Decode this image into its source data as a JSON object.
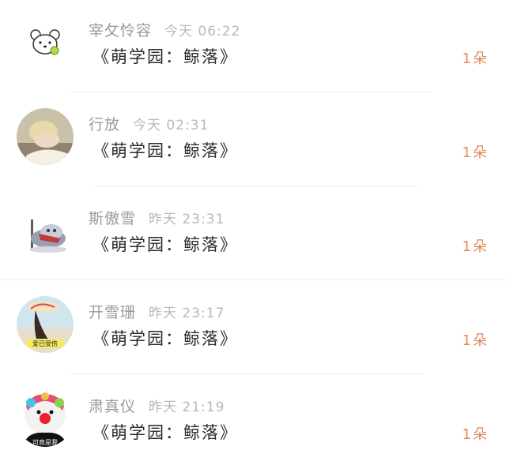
{
  "messages": [
    {
      "name": "宰攵怜容",
      "time": "今天 06:22",
      "text": "《萌学园：鲸落》",
      "count": "1朵",
      "avatar_icon": "bear-icon"
    },
    {
      "name": "行放",
      "time": "今天 02:31",
      "text": "《萌学园：鲸落》",
      "count": "1朵",
      "avatar_icon": "user-photo"
    },
    {
      "name": "斯傲雪",
      "time": "昨天 23:31",
      "text": "《萌学园：鲸落》",
      "count": "1朵",
      "avatar_icon": "character-icon"
    },
    {
      "name": "开雪珊",
      "time": "昨天 23:17",
      "text": "《萌学园：鲸落》",
      "count": "1朵",
      "avatar_icon": "user-photo",
      "avatar_caption": "爱已受伤"
    },
    {
      "name": "肃真仪",
      "time": "昨天 21:19",
      "text": "《萌学园：鲸落》",
      "count": "1朵",
      "avatar_icon": "clown-icon",
      "avatar_caption": "可竟是我"
    }
  ],
  "colors": {
    "count": "#e0895a",
    "name": "#9a9a9a",
    "time": "#b8b8b8",
    "text": "#2b2b2b"
  }
}
